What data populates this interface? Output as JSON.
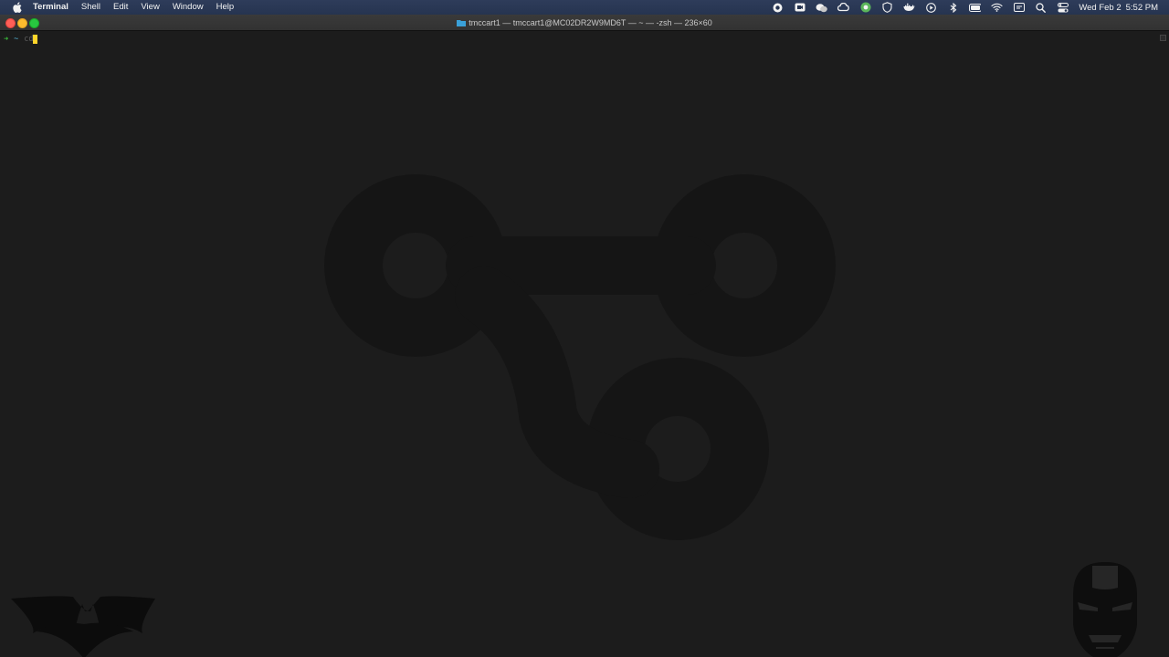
{
  "menubar": {
    "app_name": "Terminal",
    "items": [
      "Shell",
      "Edit",
      "View",
      "Window",
      "Help"
    ],
    "tray_icons": [
      "record-icon",
      "zoom-icon",
      "wechat-icon",
      "creative-cloud-icon",
      "chrome-icon",
      "vpn-icon",
      "docker-icon",
      "play-icon",
      "bluetooth-icon",
      "battery-icon",
      "wifi-icon",
      "display-icon",
      "search-icon",
      "control-center-icon"
    ],
    "clock_date": "Wed Feb 2",
    "clock_time": "5:52 PM"
  },
  "window": {
    "title": "tmccart1 — tmccart1@MC02DR2W9MD6T — ~ — -zsh — 236×60"
  },
  "terminal": {
    "prompt_arrow": "➜",
    "prompt_dir": "~",
    "typed_command": "cd",
    "cursor_color": "#ffd52a"
  },
  "colors": {
    "menubar_bg": "#263450",
    "terminal_bg": "#1c1c1c",
    "prompt_green": "#3cc83c",
    "prompt_blue": "#55b5d6"
  }
}
